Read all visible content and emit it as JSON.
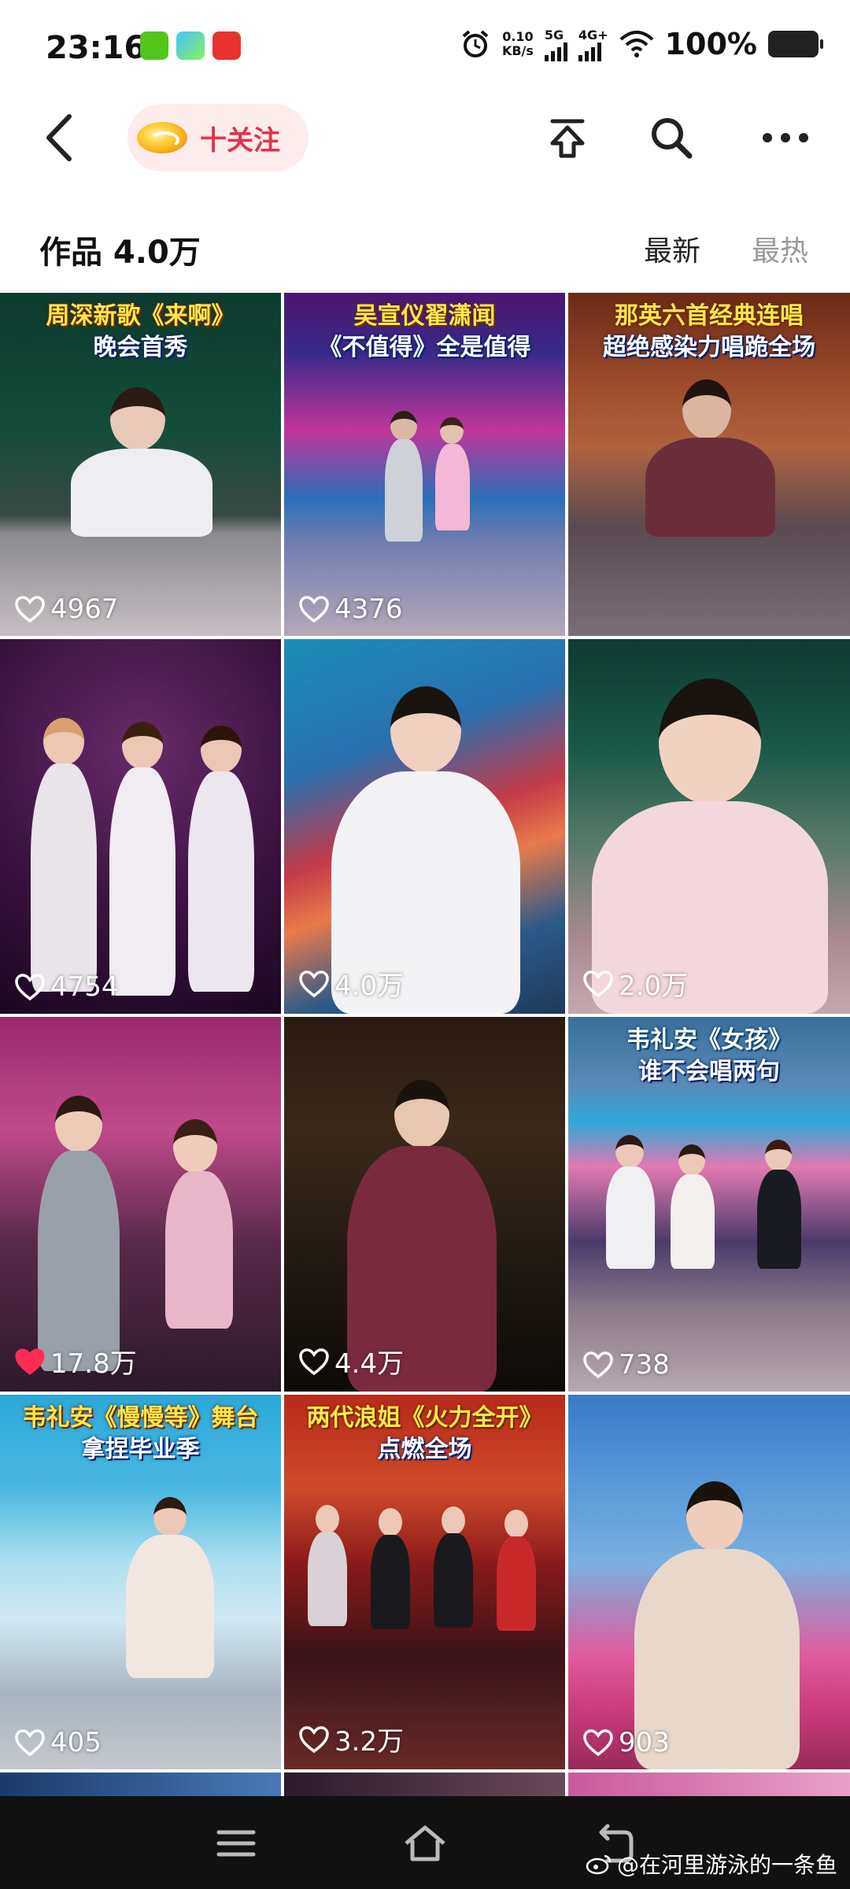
{
  "status_bar": {
    "time": "23:16",
    "net_speed_value": "0.10",
    "net_speed_unit": "KB/s",
    "sim1": "5G",
    "sim2": "4G+",
    "battery": "100%"
  },
  "header": {
    "follow_label": "十关注"
  },
  "works": {
    "title": "作品 4.0万",
    "sort_newest": "最新",
    "sort_hot": "最热"
  },
  "videos": [
    {
      "caption1": "周深新歌《来啊》",
      "caption2": "晚会首秀",
      "likes": "4967",
      "liked": false
    },
    {
      "caption1": "吴宣仪翟潇闻",
      "caption2": "《不值得》全是值得",
      "likes": "4376",
      "liked": false
    },
    {
      "caption1": "那英六首经典连唱",
      "caption2": "超绝感染力唱跪全场",
      "likes": "",
      "liked": false
    },
    {
      "caption1": "",
      "caption2": "",
      "likes": "4754",
      "liked": false
    },
    {
      "caption1": "",
      "caption2": "",
      "likes": "4.0万",
      "liked": false
    },
    {
      "caption1": "",
      "caption2": "",
      "likes": "2.0万",
      "liked": false
    },
    {
      "caption1": "",
      "caption2": "",
      "likes": "17.8万",
      "liked": true
    },
    {
      "caption1": "",
      "caption2": "",
      "likes": "4.4万",
      "liked": false
    },
    {
      "caption1": "韦礼安《女孩》",
      "caption2": "谁不会唱两句",
      "likes": "738",
      "liked": false
    },
    {
      "caption1": "韦礼安《慢慢等》舞台",
      "caption2": "拿捏毕业季",
      "likes": "405",
      "liked": false
    },
    {
      "caption1": "两代浪姐《火力全开》",
      "caption2": "点燃全场",
      "likes": "3.2万",
      "liked": false
    },
    {
      "caption1": "",
      "caption2": "",
      "likes": "903",
      "liked": false
    }
  ],
  "watermark": "@在河里游泳的一条鱼",
  "colors": {
    "follow": "#e0344b",
    "liked_heart": "#ff2d55",
    "chip_bg": "#fdecec"
  }
}
